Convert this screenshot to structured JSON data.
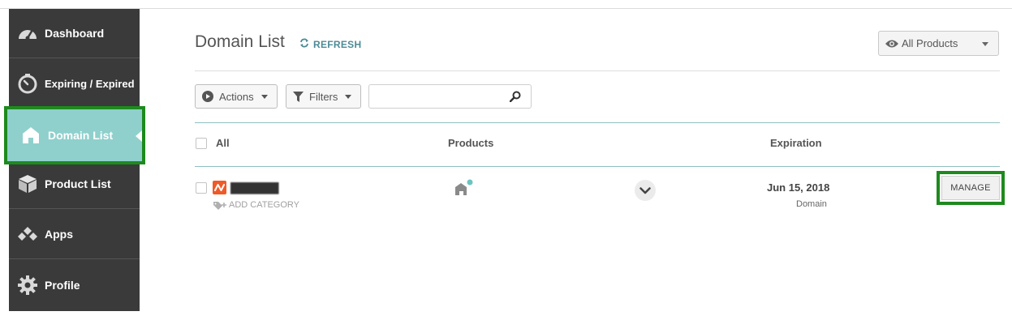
{
  "sidebar": {
    "items": [
      {
        "label": "Dashboard",
        "icon": "speedometer-icon"
      },
      {
        "label": "Expiring / Expired",
        "icon": "stopwatch-icon"
      },
      {
        "label": "Domain List",
        "icon": "house-icon",
        "active": true
      },
      {
        "label": "Product List",
        "icon": "box-icon"
      },
      {
        "label": "Apps",
        "icon": "diamonds-icon"
      },
      {
        "label": "Profile",
        "icon": "gear-icon"
      }
    ]
  },
  "header": {
    "title": "Domain List",
    "refresh_label": "REFRESH",
    "product_filter": "All Products"
  },
  "toolbar": {
    "actions_label": "Actions",
    "filters_label": "Filters",
    "search_value": ""
  },
  "table": {
    "columns": {
      "all": "All",
      "products": "Products",
      "expiration": "Expiration"
    },
    "rows": [
      {
        "domain": "███████",
        "add_category": "ADD CATEGORY",
        "expiration_date": "Jun 15, 2018",
        "expiration_type": "Domain",
        "manage_label": "MANAGE"
      }
    ]
  },
  "colors": {
    "sidebar_bg": "#3a3a3a",
    "active_bg": "#8fd0cc",
    "highlight_border": "#1e8a1e",
    "accent": "#4e8a95",
    "brand_logo": "#f05a28"
  }
}
